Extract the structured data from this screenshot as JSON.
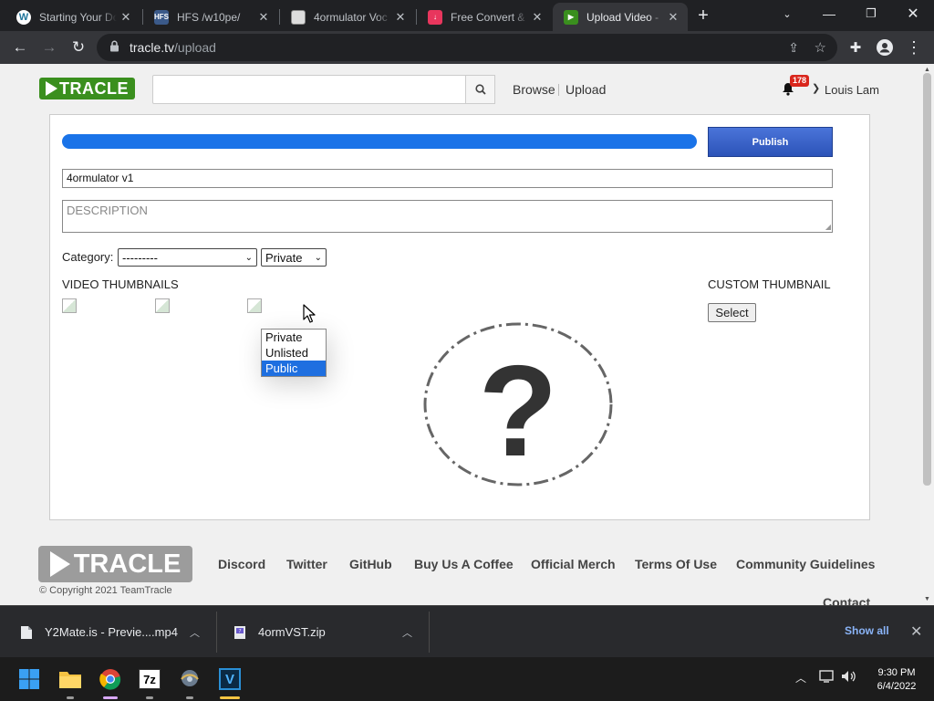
{
  "browser": {
    "tabs": [
      {
        "title": "Starting Your Do",
        "favicon": "wordpress-icon",
        "active": false
      },
      {
        "title": "HFS /w10pe/",
        "favicon": "hfs-icon",
        "active": false
      },
      {
        "title": "4ormulator Voc",
        "favicon": "page-icon",
        "active": false
      },
      {
        "title": "Free Convert &",
        "favicon": "download-icon",
        "active": false
      },
      {
        "title": "Upload Video -",
        "favicon": "tracle-icon",
        "active": true
      }
    ],
    "url_host": "tracle.tv",
    "url_path": "/upload"
  },
  "site": {
    "logo_text": "TRACLE",
    "search_placeholder": "",
    "nav": {
      "browse": "Browse",
      "upload": "Upload"
    },
    "notification_count": "178",
    "username": "Louis Lam",
    "accent_color": "#3a8f1e"
  },
  "upload": {
    "progress": 1.0,
    "publish_label": "Publish",
    "title_value": "4ormulator v1",
    "description_placeholder": "DESCRIPTION",
    "category_label": "Category:",
    "category_value": "---------",
    "privacy_value": "Private",
    "privacy_options": [
      "Private",
      "Unlisted",
      "Public"
    ],
    "privacy_highlighted": "Public",
    "video_thumbnails_label": "VIDEO THUMBNAILS",
    "custom_thumbnail_label": "CUSTOM THUMBNAIL",
    "select_label": "Select",
    "placeholder_glyph": "?"
  },
  "footer": {
    "logo_text": "TRACLE",
    "copyright": "© Copyright 2021 TeamTracle",
    "links": [
      "Discord",
      "Twitter",
      "GitHub",
      "Buy Us A Coffee",
      "Official Merch",
      "Terms Of Use",
      "Community Guidelines"
    ],
    "contact": "Contact"
  },
  "downloads": {
    "items": [
      {
        "name": "Y2Mate.is - Previe....mp4",
        "icon": "file-icon"
      },
      {
        "name": "4ormVST.zip",
        "icon": "zip-icon"
      }
    ],
    "show_all": "Show all"
  },
  "taskbar": {
    "time": "9:30 PM",
    "date": "6/4/2022",
    "apps": [
      "start-icon",
      "file-explorer-icon",
      "chrome-icon",
      "7zip-icon",
      "app-icon",
      "vst-icon"
    ]
  }
}
